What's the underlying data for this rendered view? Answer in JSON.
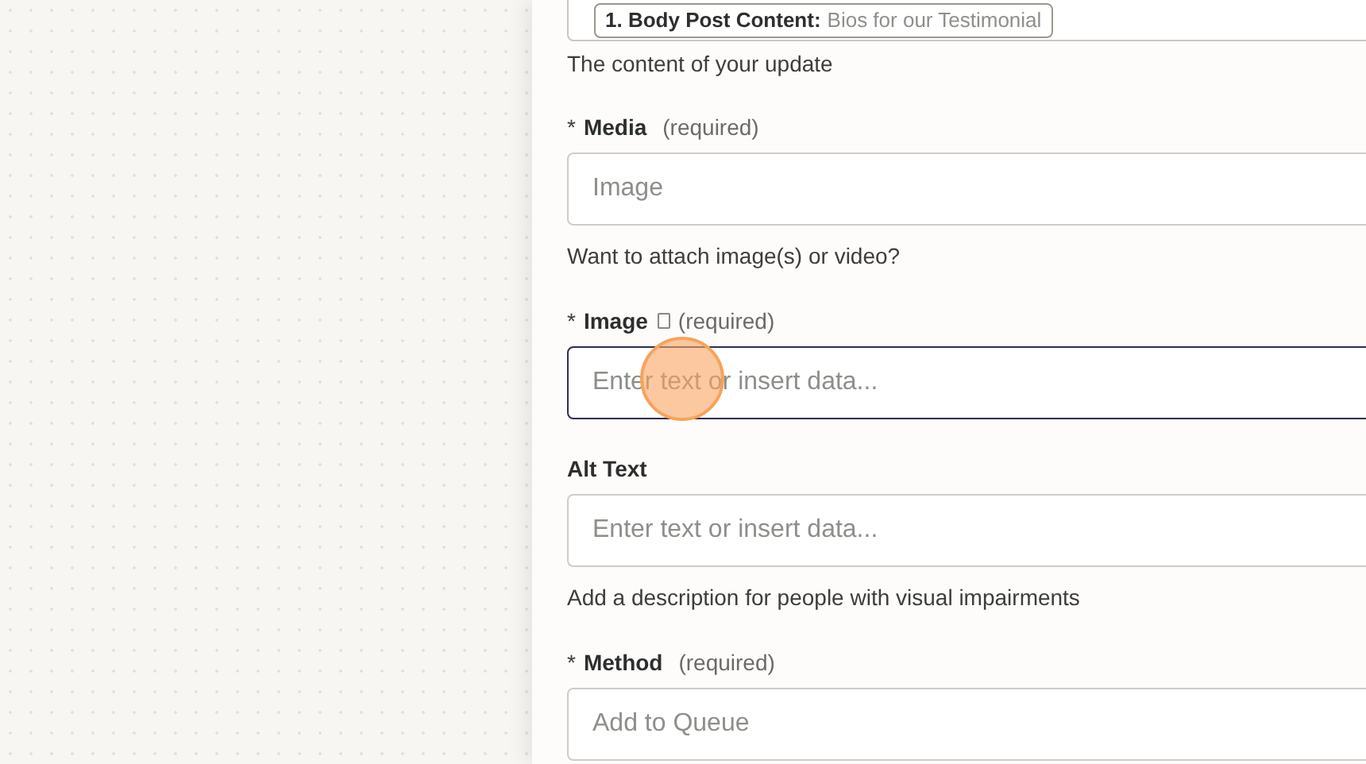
{
  "top_field": {
    "pill_label": "1. Body Post Content:",
    "pill_value": "Bios for our Testimonial",
    "hint": "The content of your update"
  },
  "fields": [
    {
      "marker": "*",
      "label": "Media",
      "note": "(required)",
      "doc_icon": false,
      "value": "Image",
      "focused": false,
      "hint": "Want to attach image(s) or video?"
    },
    {
      "marker": "*",
      "label": "Image",
      "note": "(required)",
      "doc_icon": true,
      "placeholder": "Enter text or insert data...",
      "focused": true
    },
    {
      "label": "Alt Text",
      "doc_icon": false,
      "placeholder": "Enter text or insert data...",
      "focused": false,
      "hint": "Add a description for people with visual impairments"
    },
    {
      "marker": "*",
      "label": "Method",
      "note": "(required)",
      "doc_icon": false,
      "value": "Add to Queue",
      "focused": false
    }
  ]
}
